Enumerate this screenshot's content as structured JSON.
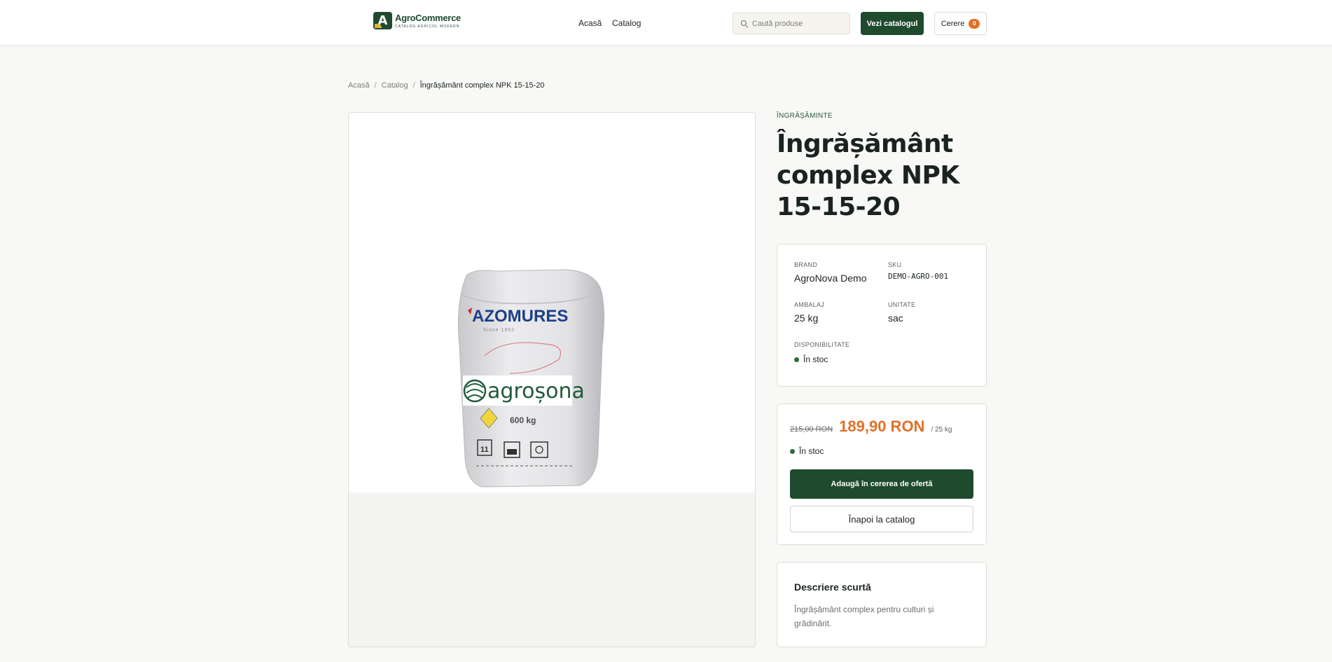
{
  "header": {
    "logo_title": "AgroCommerce",
    "logo_subtitle": "CATALOG AGRICOL MODERN",
    "nav": {
      "home": "Acasă",
      "catalog": "Catalog"
    },
    "search_placeholder": "Caută produse",
    "catalog_button": "Vezi catalogul",
    "request_button": "Cerere",
    "request_count": "0"
  },
  "breadcrumb": {
    "home": "Acasă",
    "catalog": "Catalog",
    "current": "Îngrășământ complex NPK 15-15-20"
  },
  "product": {
    "category": "ÎNGRĂȘĂMINTE",
    "title": "Îngrășământ complex NPK 15-15-20",
    "image_text": {
      "brand": "AZOMURES",
      "since": "Since 1962",
      "watermark": "agroșona",
      "weight": "600 kg"
    },
    "specs": {
      "brand_label": "BRAND",
      "brand_value": "AgroNova Demo",
      "sku_label": "SKU",
      "sku_value": "DEMO-AGRO-001",
      "pack_label": "AMBALAJ",
      "pack_value": "25 kg",
      "unit_label": "UNITATE",
      "unit_value": "sac",
      "avail_label": "DISPONIBILITATE",
      "avail_value": "În stoc"
    },
    "price": {
      "old": "215,00 RON",
      "new": "189,90 RON",
      "per_unit": "/ 25 kg",
      "stock": "În stoc",
      "add_button": "Adaugă în cererea de ofertă",
      "back_button": "Înapoi la catalog"
    },
    "description": {
      "title": "Descriere scurtă",
      "text": "Îngrășământ complex pentru culturi și grădinărit."
    }
  },
  "colors": {
    "brand_green": "#1f4a2e",
    "price_orange": "#e0712a",
    "badge_orange": "#e2702a"
  }
}
